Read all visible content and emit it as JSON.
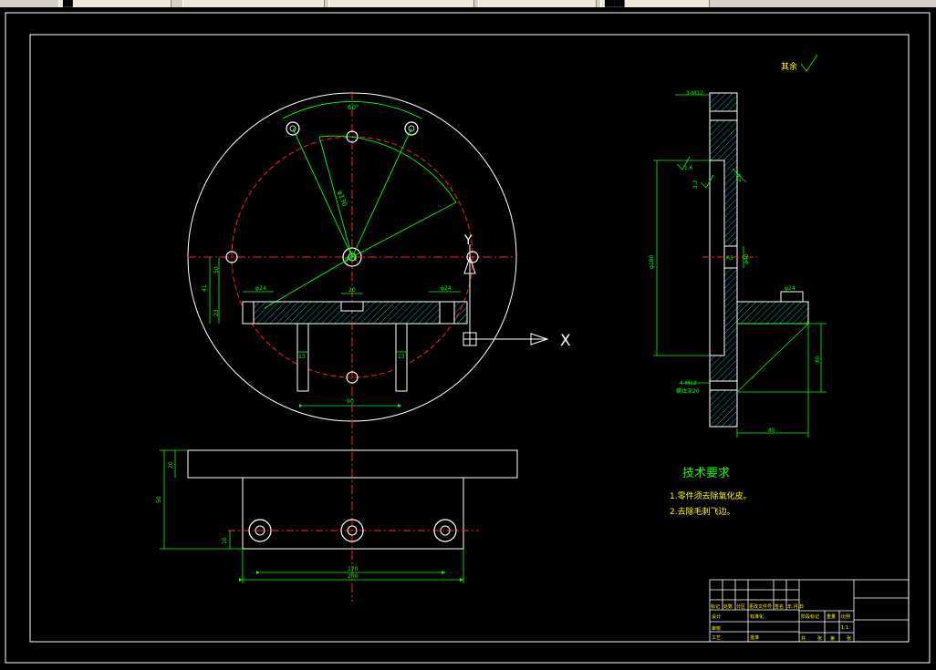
{
  "tabs": [
    {
      "label": "██"
    },
    {
      "label": ""
    },
    {
      "label": ""
    },
    {
      "label": ""
    },
    {
      "label": ""
    },
    {
      "label": "████"
    }
  ],
  "colors": {
    "background": "#000000",
    "outline": "#ffffff",
    "centerline": "#ff2020",
    "dimension": "#00ff00",
    "hatch": "#00ffff",
    "text": "#00ff00",
    "marker": "#ffff00"
  },
  "drawing": {
    "axis_y_label": "Y",
    "axis_x_label": "X",
    "angle_label": "60°",
    "pcd_label": "φ130",
    "hole_label_top": "φ16",
    "slot_dim_left": "φ24",
    "slot_dim_right": "φ24",
    "slot_width": "20",
    "dim_vertical_1": "41",
    "dim_vertical_2": "50",
    "dim_vertical_3": "23",
    "pin_dim_left": "13",
    "pin_dim_right": "13",
    "pin_spacing": "90",
    "side_top_label": "3-M12",
    "side_bottom_label": "4-M12",
    "side_bottom_sub": "螺纹深20",
    "side_dim_tall": "φ180",
    "side_dim_radius": "R5",
    "side_dim_mid": "φ40",
    "side_slot": "φ24",
    "side_dim_right": "80",
    "side_dim_bottom": "80",
    "side_roughness_1": "1.6",
    "side_roughness_2": "3.2",
    "side_roughness_3": "1.6",
    "roughness_note": "其余",
    "bottom_dim_height": "50",
    "bottom_dim_top": "20",
    "bottom_dim_small": "10",
    "bottom_dim_width_inner": "170",
    "bottom_dim_width_outer": "200",
    "tech_title": "技术要求",
    "tech_items": [
      "1.零件须去除氧化皮。",
      "2.去除毛刺飞边。"
    ],
    "title_block": {
      "row_labels": [
        "标记",
        "处数",
        "分区",
        "更改文件号",
        "签名",
        "年.月.日"
      ],
      "design": "设计",
      "standard": "标准化",
      "review": "审核",
      "process": "工艺",
      "approve": "批准",
      "stage": "阶段标记",
      "weight": "重量",
      "scale": "比例",
      "scale_value": "1:1",
      "sheet_total": "共",
      "sheet": "张",
      "sheet_no": "第"
    }
  }
}
